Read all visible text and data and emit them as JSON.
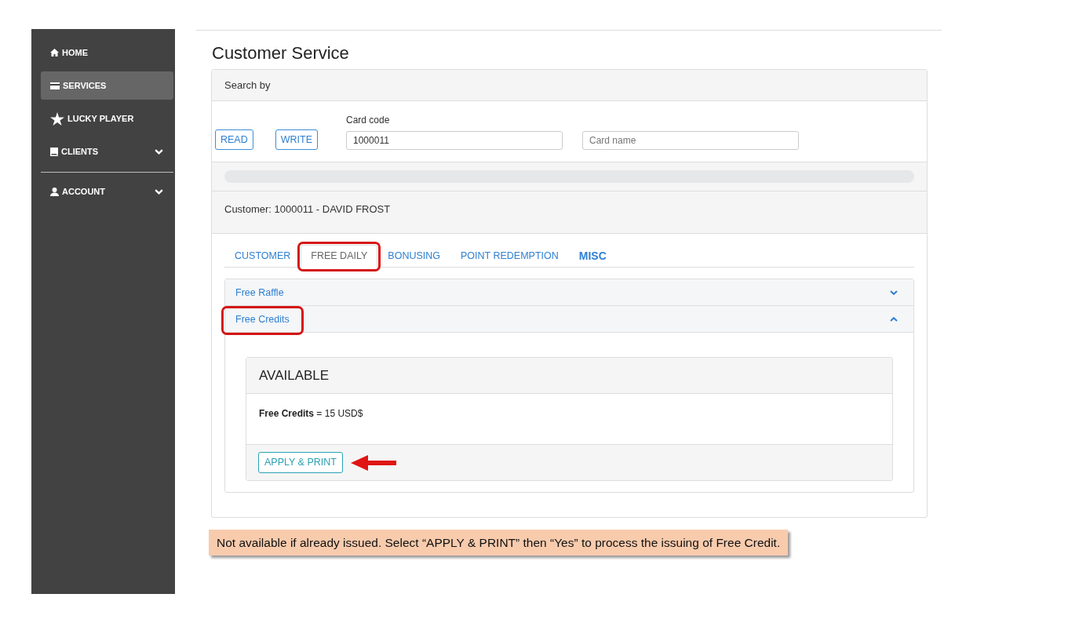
{
  "sidebar": {
    "sections": [
      {
        "items": [
          {
            "label": "HOME",
            "kind": "link",
            "selected": false
          },
          {
            "label": "SERVICES",
            "kind": "link",
            "selected": true
          },
          {
            "label": "LUCKY PLAYER",
            "kind": "link",
            "selected": false
          },
          {
            "label": "CLIENTS",
            "kind": "menu",
            "selected": false
          }
        ]
      },
      {
        "items": [
          {
            "label": "ACCOUNT",
            "kind": "menu",
            "selected": false
          }
        ]
      }
    ]
  },
  "page": {
    "title": "Customer Service"
  },
  "search": {
    "title": "Search by",
    "buttons": [
      "READ",
      "WRITE"
    ],
    "card_code": {
      "label": "Card code",
      "value": "1000011"
    },
    "card_name": {
      "placeholder": "Card name"
    },
    "progress": {
      "level": 0
    }
  },
  "customer": {
    "title": "Customer: 1000011 - DAVID FROST"
  },
  "tabs": [
    {
      "label": "CUSTOMER",
      "selected": false,
      "emphasized": false,
      "highlighted": false
    },
    {
      "label": "FREE DAILY",
      "selected": true,
      "emphasized": false,
      "highlighted": true
    },
    {
      "label": "BONUSING",
      "selected": false,
      "emphasized": false,
      "highlighted": false
    },
    {
      "label": "POINT REDEMPTION",
      "selected": false,
      "emphasized": false,
      "highlighted": false
    },
    {
      "label": "MISC",
      "selected": false,
      "emphasized": true,
      "highlighted": false
    }
  ],
  "accordion": [
    {
      "title": "Free Raffle",
      "expanded": false,
      "highlighted": false
    },
    {
      "title": "Free Credits",
      "expanded": true,
      "highlighted": true,
      "panel": {
        "title": "AVAILABLE",
        "text": "**Free Credits** = 15 USD$",
        "button": {
          "label": "APPLY & PRINT",
          "pointed_at": true
        }
      }
    }
  ],
  "note": "Not available if already issued. Select “APPLY & PRINT” then “Yes” to process the issuing of Free Credit."
}
